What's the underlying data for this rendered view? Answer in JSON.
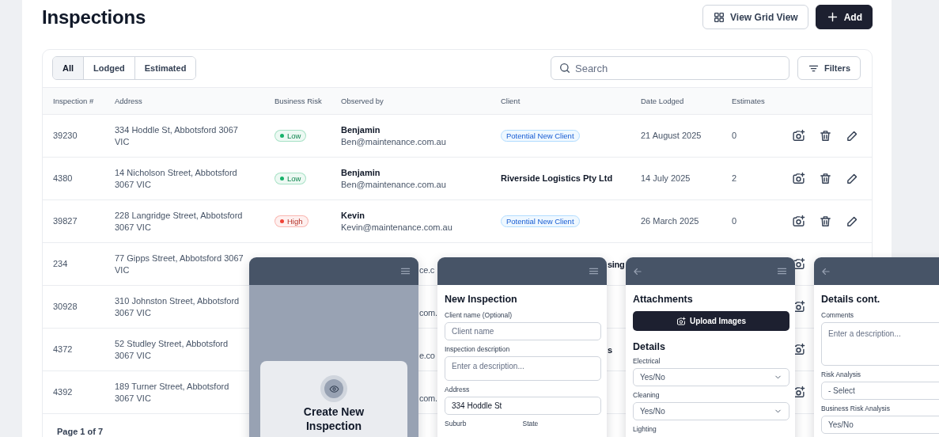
{
  "page_title": "Inspections",
  "header_buttons": [
    {
      "label": "View Grid View",
      "kind": "outline"
    },
    {
      "label": "Add",
      "kind": "primary"
    }
  ],
  "tabs": [
    {
      "label": "All",
      "selected": true
    },
    {
      "label": "Lodged",
      "selected": false
    },
    {
      "label": "Estimated",
      "selected": false
    }
  ],
  "search": {
    "placeholder": "Search"
  },
  "filters_button": "Filters",
  "table": {
    "columns": [
      "Inspection #",
      "Address",
      "Business Risk",
      "Observed by",
      "Client",
      "Date Lodged",
      "Estimates"
    ],
    "rows": [
      {
        "kind": "full",
        "number": "39230",
        "address": "334 Hoddle St, Abbotsford 3067 VIC",
        "risk": {
          "label": "Low",
          "color": "#17b26a"
        },
        "observer_name": "Benjamin",
        "observer_email": "Ben@maintenance.com.au",
        "client": {
          "label": "Potential New Client",
          "kind": "badge"
        },
        "date": "21 August 2025",
        "estimates": "0"
      },
      {
        "kind": "full",
        "number": "4380",
        "address": "14 Nicholson Street, Abbotsford 3067 VIC",
        "risk": {
          "label": "Low",
          "color": "#17b26a"
        },
        "observer_name": "Benjamin",
        "observer_email": "Ben@maintenance.com.au",
        "client": {
          "label": "Riverside Logistics Pty Ltd",
          "kind": "text"
        },
        "date": "14 July 2025",
        "estimates": "2"
      },
      {
        "kind": "full",
        "number": "39827",
        "address": "228 Langridge Street, Abbotsford 3067 VIC",
        "risk": {
          "label": "High",
          "color": "#f04438"
        },
        "observer_name": "Kevin",
        "observer_email": "Kevin@maintenance.com.au",
        "client": {
          "label": "Potential New Client",
          "kind": "badge"
        },
        "date": "26 March 2025",
        "estimates": "0"
      },
      {
        "kind": "overlapped",
        "number": "234",
        "address": "77 Gipps Street, Abbotsford 3067 VIC",
        "observer_fragment": "ce.c",
        "client_fragment": "sing"
      },
      {
        "kind": "overlapped",
        "number": "30928",
        "address": "310 Johnston Street, Abbotsford 3067 VIC",
        "observer_fragment": "com."
      },
      {
        "kind": "overlapped",
        "number": "4372",
        "address": "52 Studley Street, Abbotsford 3067 VIC",
        "observer_fragment": "e.co",
        "client_fragment": "s"
      },
      {
        "kind": "overlapped",
        "number": "4392",
        "address": "189 Turner Street, Abbotsford 3067 VIC",
        "observer_fragment": "com."
      }
    ]
  },
  "pagination": "Page 1 of 7",
  "mockups": [
    {
      "kind": "splash",
      "back": false,
      "menu": true,
      "card_title": "Create New Inspection"
    },
    {
      "kind": "form",
      "back": false,
      "menu": true,
      "items": [
        {
          "kind": "heading",
          "text": "New Inspection"
        },
        {
          "kind": "label",
          "text": "Client name (Optional)"
        },
        {
          "kind": "input",
          "placeholder": "Client name"
        },
        {
          "kind": "label",
          "text": "Inspection description"
        },
        {
          "kind": "textarea",
          "placeholder": "Enter a description..."
        },
        {
          "kind": "label",
          "text": "Address"
        },
        {
          "kind": "input",
          "value": "334 Hoddle St"
        },
        {
          "kind": "label_pair",
          "labels": [
            "Suburb",
            "State"
          ]
        }
      ]
    },
    {
      "kind": "form",
      "back": true,
      "menu": true,
      "items": [
        {
          "kind": "heading",
          "text": "Attachments"
        },
        {
          "kind": "button",
          "text": "Upload Images"
        },
        {
          "kind": "section",
          "text": "Details"
        },
        {
          "kind": "label",
          "text": "Electrical"
        },
        {
          "kind": "select",
          "value": "Yes/No"
        },
        {
          "kind": "label",
          "text": "Cleaning"
        },
        {
          "kind": "select",
          "value": "Yes/No"
        },
        {
          "kind": "label",
          "text": "Lighting"
        }
      ]
    },
    {
      "kind": "form",
      "back": true,
      "menu": false,
      "items": [
        {
          "kind": "heading",
          "text": "Details cont."
        },
        {
          "kind": "label",
          "text": "Comments"
        },
        {
          "kind": "textarea_large",
          "placeholder": "Enter a description..."
        },
        {
          "kind": "label",
          "text": "Risk Analysis"
        },
        {
          "kind": "select_cut",
          "value": "- Select"
        },
        {
          "kind": "label",
          "text": "Business Risk Analysis"
        },
        {
          "kind": "select_cut",
          "value": "Yes/No"
        }
      ]
    }
  ]
}
